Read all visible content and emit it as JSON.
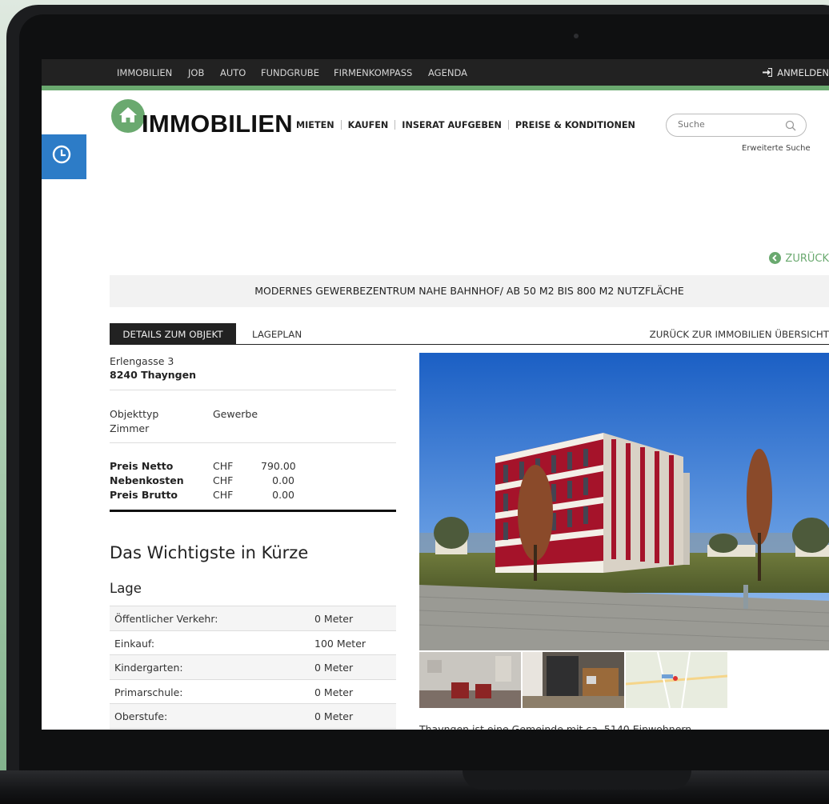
{
  "topnav": {
    "items": [
      "IMMOBILIEN",
      "JOB",
      "AUTO",
      "FUNDGRUBE",
      "FIRMENKOMPASS",
      "AGENDA"
    ],
    "login": "ANMELDEN"
  },
  "header": {
    "logo_text": "IMMOBILIEN",
    "nav": [
      "MIETEN",
      "KAUFEN",
      "INSERAT AUFGEBEN",
      "PREISE & KONDITIONEN"
    ],
    "search_placeholder": "Suche",
    "advanced_search": "Erweiterte Suche"
  },
  "back_link": "ZURÜCK",
  "listing_title": "MODERNES GEWERBEZENTRUM NAHE BAHNHOF/ AB 50 M2 BIS 800 M2 NUTZFLÄCHE",
  "tabs": {
    "details": "DETAILS ZUM OBJEKT",
    "map": "LAGEPLAN",
    "back_overview": "ZURÜCK ZUR IMMOBILIEN ÜBERSICHT"
  },
  "address": {
    "street": "Erlengasse 3",
    "city": "8240 Thayngen"
  },
  "object": {
    "type_label": "Objekttyp",
    "type_value": "Gewerbe",
    "rooms_label": "Zimmer"
  },
  "prices": [
    {
      "label": "Preis Netto",
      "currency": "CHF",
      "value": "790.00"
    },
    {
      "label": "Nebenkosten",
      "currency": "CHF",
      "value": "0.00"
    },
    {
      "label": "Preis Brutto",
      "currency": "CHF",
      "value": "0.00"
    }
  ],
  "summary_heading": "Das Wichtigste in Kürze",
  "location_heading": "Lage",
  "location": [
    {
      "label": "Öffentlicher Verkehr:",
      "value": "0 Meter"
    },
    {
      "label": "Einkauf:",
      "value": "100 Meter"
    },
    {
      "label": "Kindergarten:",
      "value": "0 Meter"
    },
    {
      "label": "Primarschule:",
      "value": "0 Meter"
    },
    {
      "label": "Oberstufe:",
      "value": "0 Meter"
    }
  ],
  "description": "Thayngen ist eine Gemeinde mit ca. 5140 Einwohnern",
  "colors": {
    "accent": "#6aa96f",
    "dark": "#222222",
    "history_button": "#2d7cc7"
  },
  "icons": [
    "login-arrow-icon",
    "house-icon",
    "search-icon",
    "clock-icon",
    "chevron-left-icon"
  ]
}
